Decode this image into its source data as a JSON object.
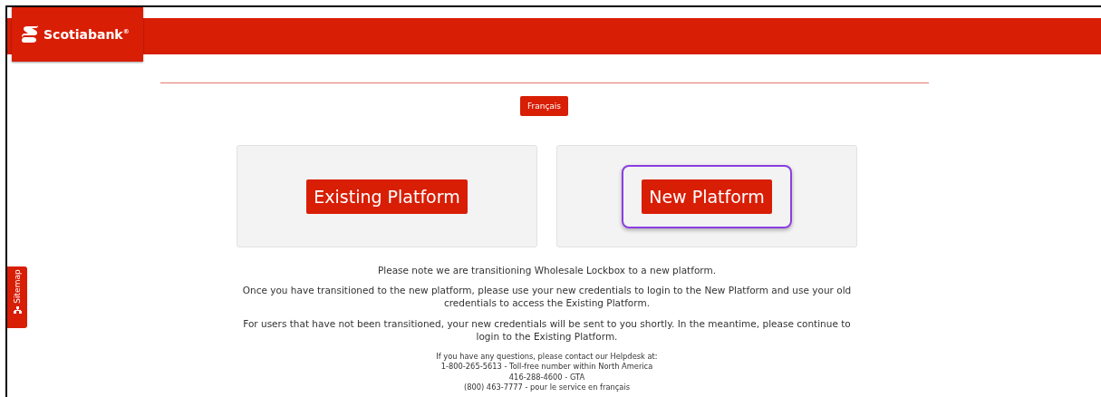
{
  "header": {
    "logo": "Scotiabank",
    "logo_mark": "®"
  },
  "language_button": "Français",
  "platforms": [
    {
      "label": "Existing Platform",
      "highlighted": false
    },
    {
      "label": "New Platform",
      "highlighted": true
    }
  ],
  "notices": [
    "Please note we are transitioning Wholesale Lockbox to a new platform.",
    "Once you have transitioned to the new platform, please use your new credentials to login to the New Platform and use your old credentials to access the Existing Platform.",
    "For users that have not been transitioned, your new credentials will be sent to you shortly. In the meantime, please continue to login to the Existing Platform."
  ],
  "helpdesk": [
    "If you have any questions, please contact our Helpdesk at:",
    "1-800-265-5613 - Toll-free number within North America",
    "416-288-4600 - GTA",
    "(800) 463-7777 - pour le service en français"
  ],
  "sitemap_tab": "Sitemap"
}
